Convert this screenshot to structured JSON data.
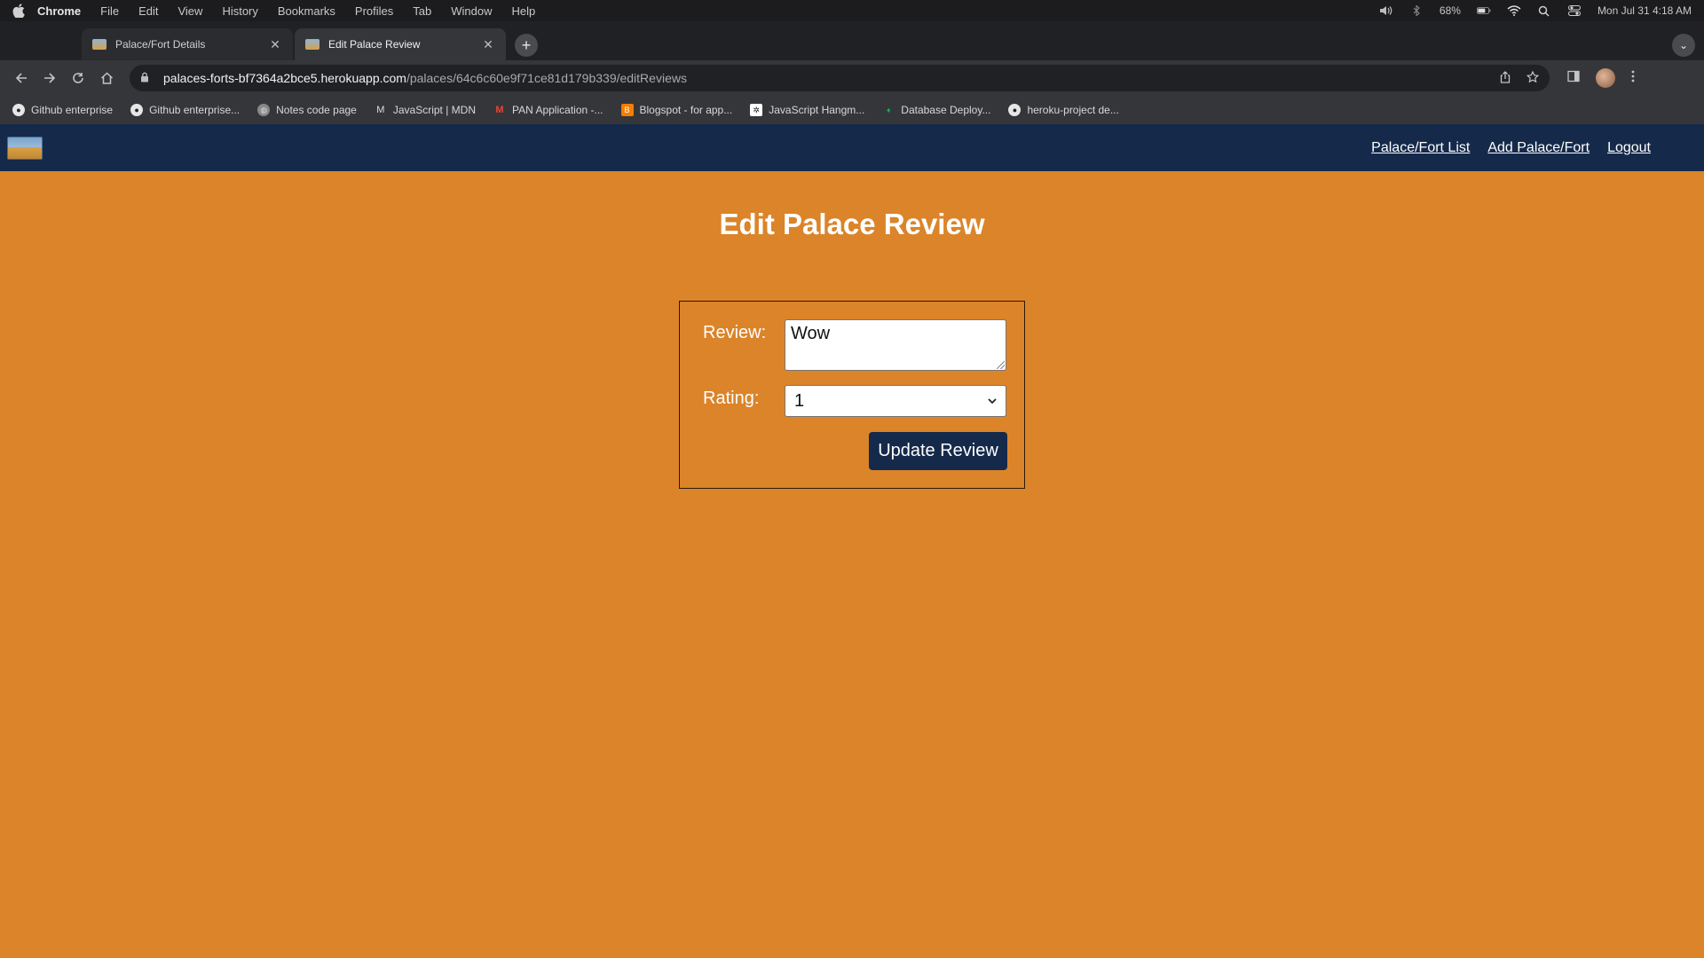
{
  "menubar": {
    "app": "Chrome",
    "items": [
      "File",
      "Edit",
      "View",
      "History",
      "Bookmarks",
      "Profiles",
      "Tab",
      "Window",
      "Help"
    ],
    "battery": "68%",
    "datetime": "Mon Jul 31  4:18 AM"
  },
  "tabs": [
    {
      "label": "Palace/Fort Details",
      "active": false
    },
    {
      "label": "Edit Palace Review",
      "active": true
    }
  ],
  "omnibox": {
    "host": "palaces-forts-bf7364a2bce5.herokuapp.com",
    "path": "/palaces/64c6c60e9f71ce81d179b339/editReviews"
  },
  "bookmarks": [
    {
      "label": "Github enterprise",
      "icon": "github-icon"
    },
    {
      "label": "Github enterprise...",
      "icon": "github-icon"
    },
    {
      "label": "Notes code page",
      "icon": "globe-icon"
    },
    {
      "label": "JavaScript | MDN",
      "icon": "mdn-icon"
    },
    {
      "label": "PAN Application -...",
      "icon": "gmail-icon"
    },
    {
      "label": "Blogspot - for app...",
      "icon": "blogger-icon"
    },
    {
      "label": "JavaScript Hangm...",
      "icon": "openai-icon"
    },
    {
      "label": "Database Deploy...",
      "icon": "mongodb-icon"
    },
    {
      "label": "heroku-project de...",
      "icon": "github-icon"
    }
  ],
  "site": {
    "nav_links": [
      "Palace/Fort List",
      "Add Palace/Fort",
      "Logout"
    ],
    "title": "Edit Palace Review",
    "form": {
      "review_label": "Review:",
      "review_value": "Wow",
      "rating_label": "Rating:",
      "rating_value": "1",
      "submit_label": "Update Review"
    }
  },
  "colors": {
    "page_background": "#db8429",
    "navbar": "#152a4b",
    "button": "#152a4b"
  }
}
